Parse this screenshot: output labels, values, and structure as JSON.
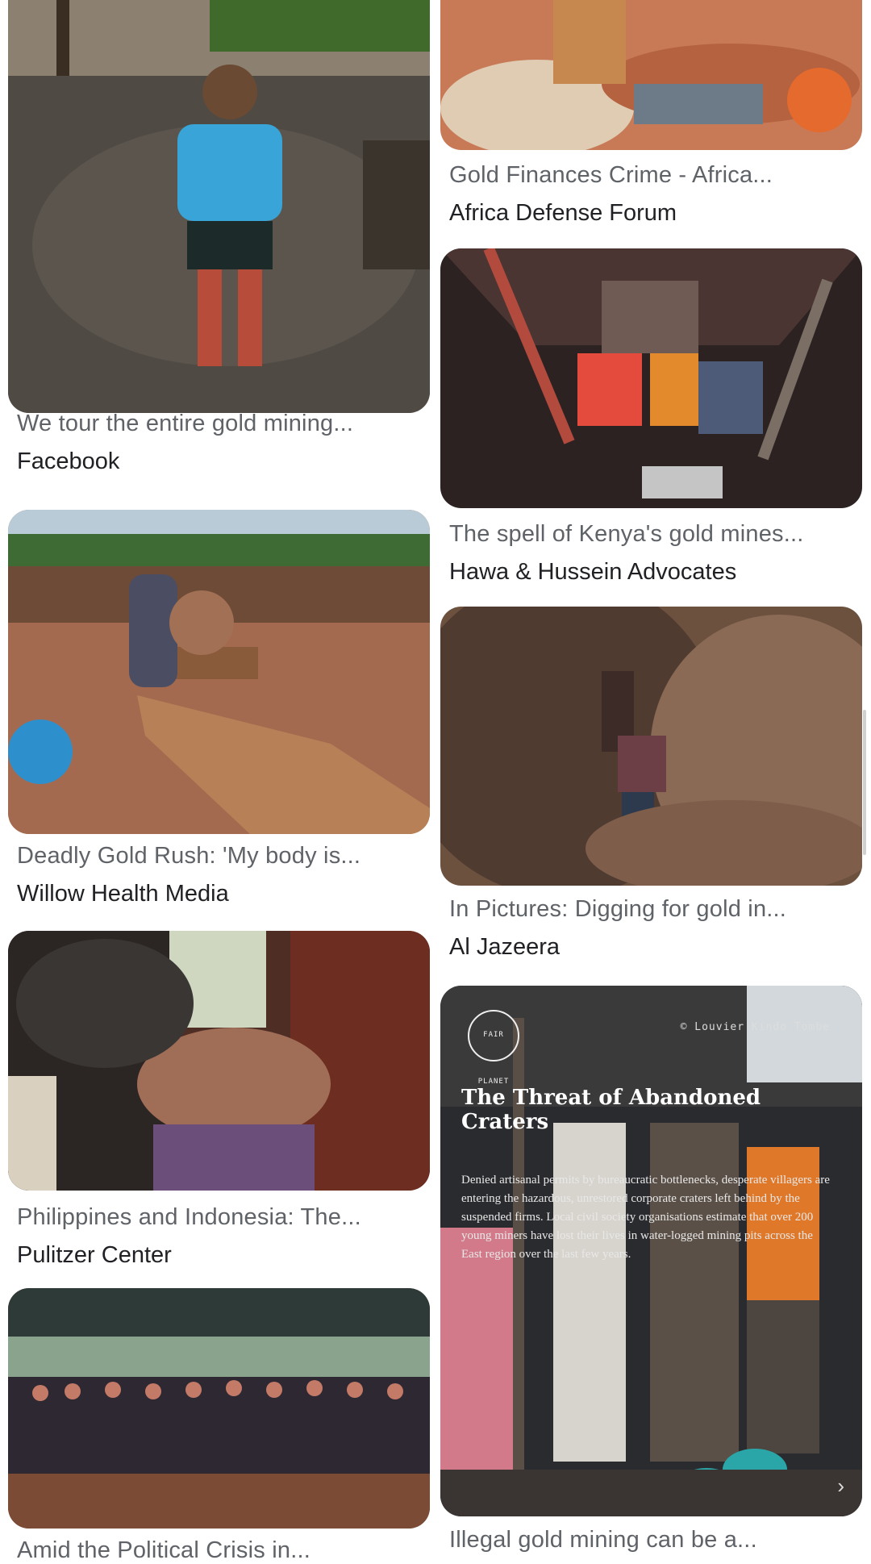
{
  "results": {
    "left": [
      {
        "title": "We tour the entire gold mining...",
        "source": "Facebook"
      },
      {
        "title": "Deadly Gold Rush: 'My body is...",
        "source": "Willow Health Media"
      },
      {
        "title": "Philippines and Indonesia: The...",
        "source": "Pulitzer Center"
      },
      {
        "title": "Amid the Political Crisis in...",
        "source": ""
      }
    ],
    "right": [
      {
        "title": "Gold Finances Crime - Africa...",
        "source": "Africa Defense Forum"
      },
      {
        "title": "The spell of Kenya's gold mines...",
        "source": "Hawa & Hussein Advocates"
      },
      {
        "title": "In Pictures: Digging for gold in...",
        "source": "Al Jazeera"
      },
      {
        "title": "Illegal gold mining can be a...",
        "source": ""
      }
    ]
  },
  "overlay": {
    "brand": "FAIR PLANET",
    "credit": "© Louvier Kindo Tombe",
    "heading": "The Threat of Abandoned Craters",
    "body": "Denied artisanal permits by bureaucratic bottlenecks, desperate villagers are entering the hazardous, unrestored corporate craters left behind by the suspended firms. Local civil society organisations estimate that over 200 young miners have lost their lives in water-logged mining pits across the East region over the last few years.",
    "next_glyph": "›"
  }
}
